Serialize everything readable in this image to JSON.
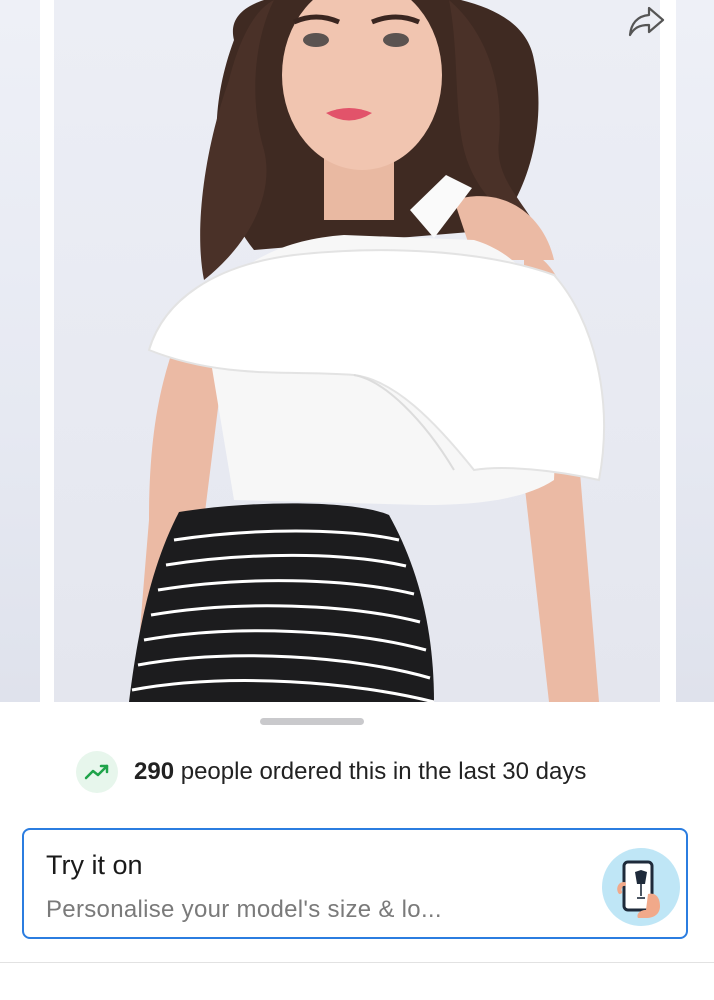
{
  "gallery": {
    "product_image_alt": "Woman wearing white off-shoulder ruffle crop top with black striped skirt",
    "share_icon": "share-icon"
  },
  "orders": {
    "icon": "trending-up-icon",
    "count": "290",
    "text": " people ordered this in the last 30 days"
  },
  "try_on": {
    "title": "Try it on",
    "subtitle": "Personalise your model's size & lo...",
    "icon": "phone-mannequin-icon"
  },
  "colors": {
    "accent_border": "#2b7de0",
    "trend_green": "#1fa34a",
    "trend_bg": "#e7f6ec"
  }
}
